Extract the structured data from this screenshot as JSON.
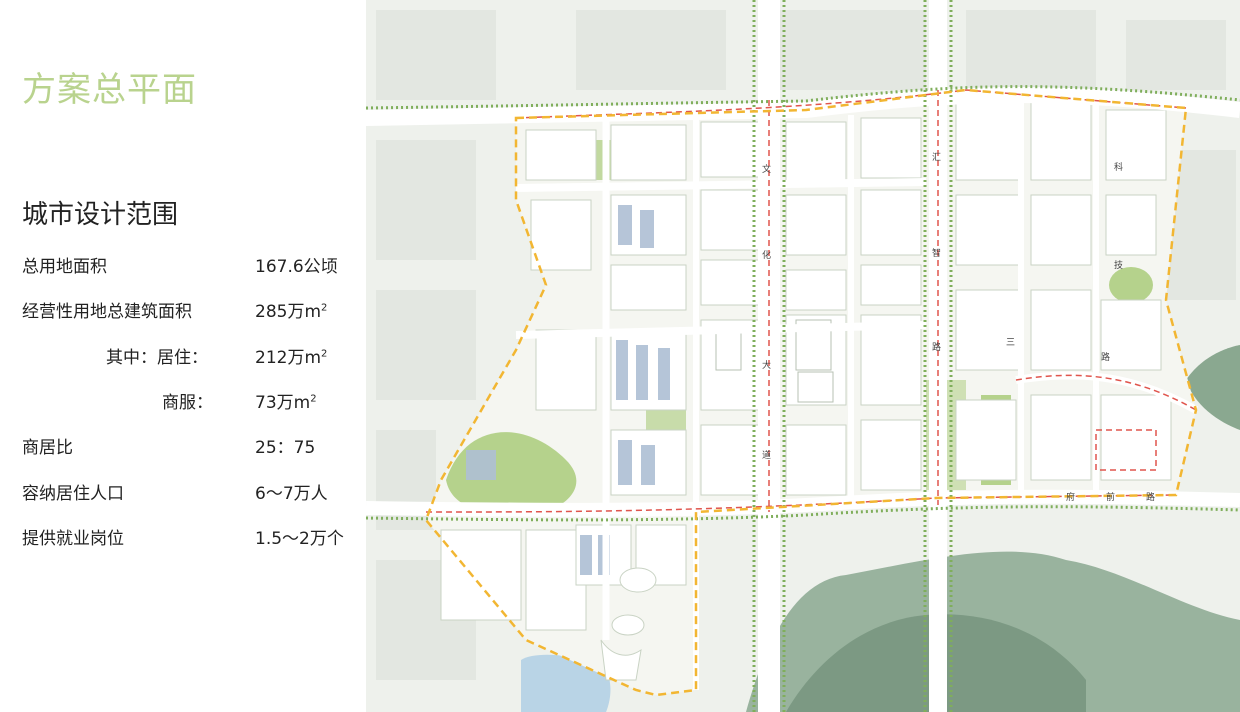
{
  "page": {
    "title": "方案总平面",
    "section_title": "城市设计范围",
    "stats": [
      {
        "label": "总用地面积",
        "value": "167.6公顷"
      },
      {
        "label": "经营性用地总建筑面积",
        "value": "285万m",
        "sup": "2"
      },
      {
        "label": "其中：居住：",
        "value": "212万m",
        "sup": "2"
      },
      {
        "label": "商服：",
        "value": "73万m",
        "sup": "2"
      },
      {
        "label": "商居比",
        "value": "25：75"
      },
      {
        "label": "容纳居住人口",
        "value": "6～7万人"
      },
      {
        "label": "提供就业岗位",
        "value": "1.5～2万个"
      }
    ]
  },
  "map": {
    "road_labels": [
      "文",
      "化",
      "大",
      "道",
      "汇",
      "智",
      "路",
      "科",
      "技",
      "三",
      "路",
      "府",
      "前",
      "路"
    ],
    "colors": {
      "boundary": "#f2b632",
      "road_dash": "#e0554d",
      "green": "#b5d28c",
      "mountain": "#7f9f86",
      "water": "#b9d4e6",
      "building": "#ffffff",
      "title": "#b9d38e"
    }
  }
}
